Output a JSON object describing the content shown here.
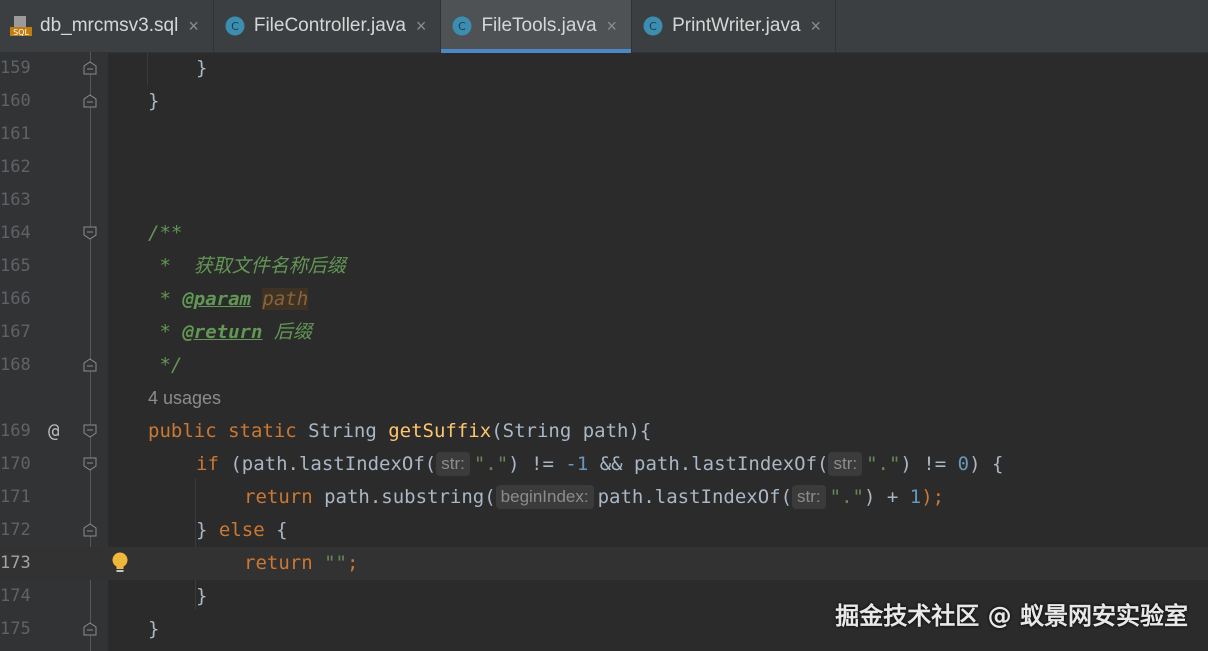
{
  "tabs": [
    {
      "label": "db_mrcmsv3.sql",
      "icon": "sql-file-icon",
      "active": false
    },
    {
      "label": "FileController.java",
      "icon": "java-class-icon",
      "active": false
    },
    {
      "label": "FileTools.java",
      "icon": "java-class-icon",
      "active": true
    },
    {
      "label": "PrintWriter.java",
      "icon": "java-class-icon",
      "active": false
    }
  ],
  "tab_close_glyph": "×",
  "sql_badge": "SQL",
  "line_numbers": [
    "159",
    "160",
    "161",
    "162",
    "163",
    "164",
    "165",
    "166",
    "167",
    "168",
    "169",
    "170",
    "171",
    "172",
    "173",
    "174",
    "175"
  ],
  "current_line": "173",
  "usages": "4 usages",
  "code": {
    "l159": "}",
    "l160": "}",
    "l164": "/**",
    "l165": " *  获取文件名称后缀",
    "l166_star": " * ",
    "l166_tag": "@param",
    "l166_name": "path",
    "l167_star": " * ",
    "l167_tag": "@return",
    "l167_desc": " 后缀",
    "l168": " */",
    "l169_kw": "public static ",
    "l169_type": "String ",
    "l169_fn": "getSuffix",
    "l169_rest": "(String path){",
    "l170_kw": "if ",
    "l170_a": "(path.lastIndexOf(",
    "l170_hint1": "str:",
    "l170_s1": "\".\"",
    "l170_b": ") != ",
    "l170_n1": "-1",
    "l170_c": " && path.lastIndexOf(",
    "l170_hint2": "str:",
    "l170_s2": "\".\"",
    "l170_d": ") != ",
    "l170_n2": "0",
    "l170_e": ") {",
    "l171_kw": "return ",
    "l171_a": "path.substring(",
    "l171_hint1": "beginIndex:",
    "l171_b": "path.lastIndexOf(",
    "l171_hint2": "str:",
    "l171_s": "\".\"",
    "l171_c": ") + ",
    "l171_n": "1",
    "l171_d": ");",
    "l172_a": "} ",
    "l172_kw": "else",
    "l172_b": " {",
    "l173_kw": "return ",
    "l173_s": "\"\"",
    "l173_semi": ";",
    "l174": "}",
    "l175": "}"
  },
  "watermark": "掘金技术社区 @ 蚁景网安实验室",
  "colors": {
    "accent": "#4a88c7",
    "keyword": "#cc7832",
    "string": "#6a8759",
    "number": "#6897bb",
    "method": "#ffc66d",
    "doc": "#629755"
  }
}
